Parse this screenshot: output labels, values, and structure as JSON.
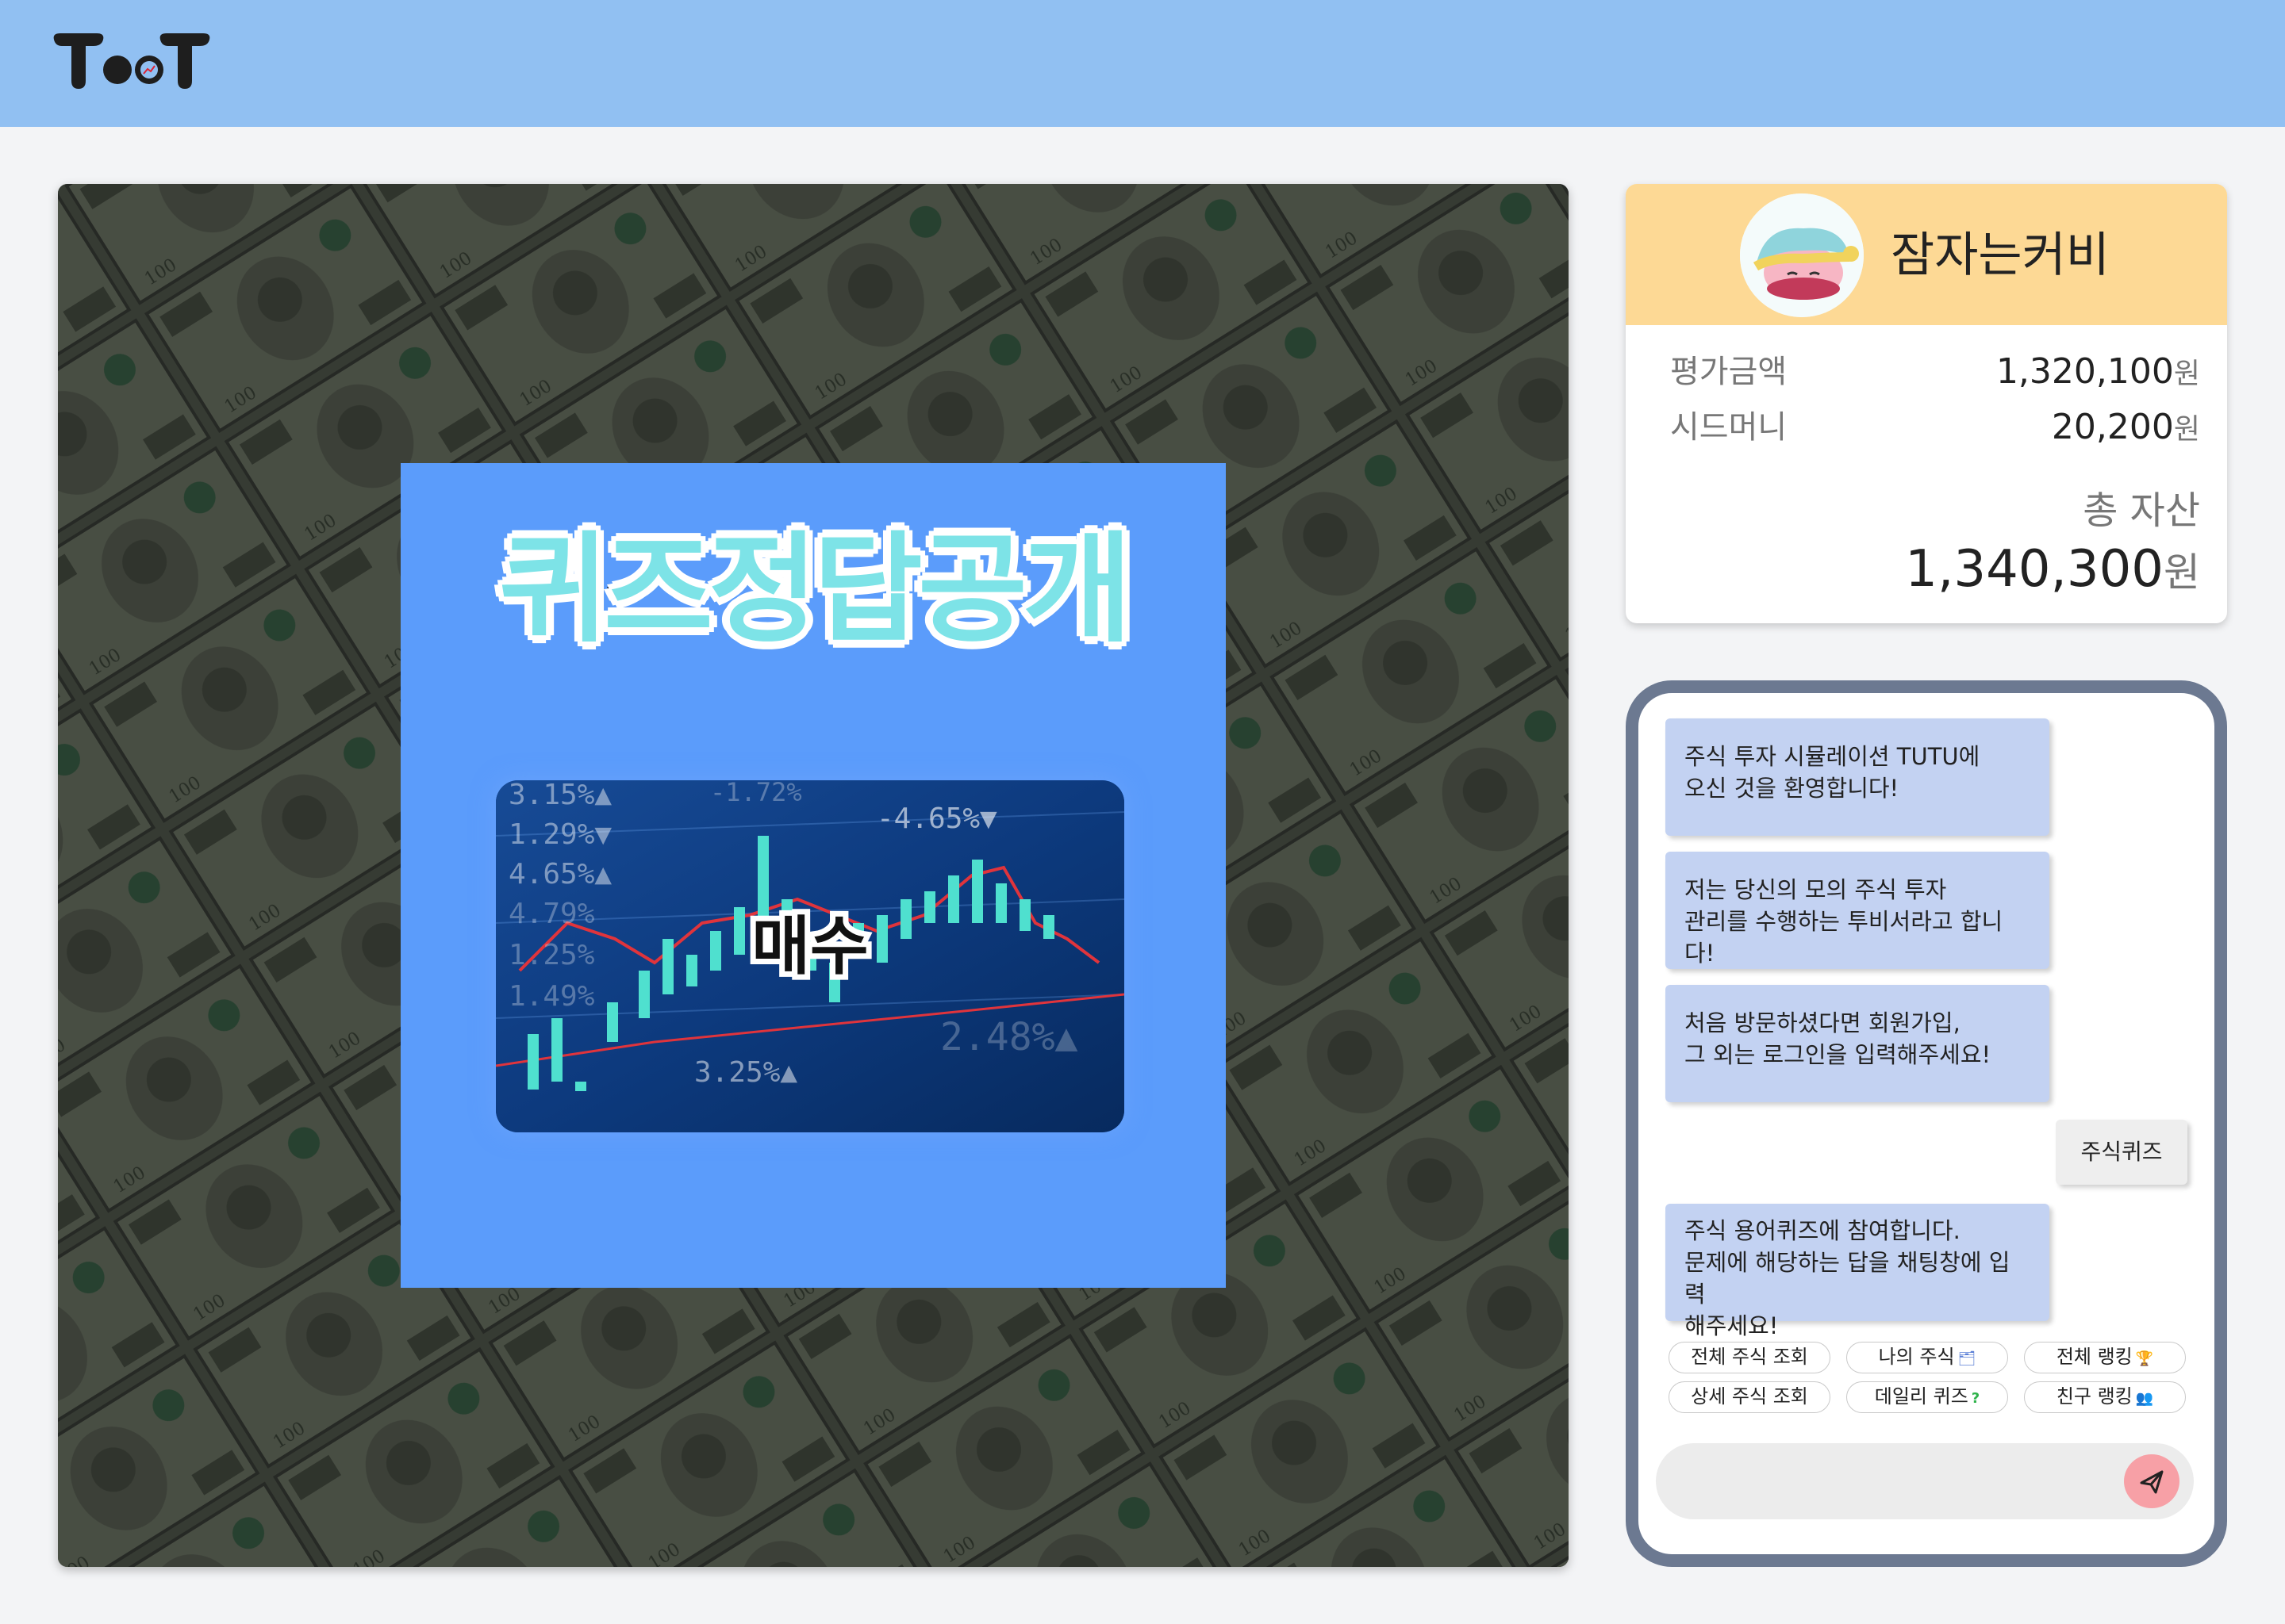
{
  "app": {
    "logo_text": "TooT"
  },
  "quiz": {
    "title": "퀴즈정답공개",
    "answer": "매수",
    "tickers": [
      "3.15%▲",
      "1.29%▼",
      "4.65%▲",
      "4.79%",
      "1.25%",
      "1.49%",
      "-1.72%",
      "-4.65%▼",
      "3.25%▲",
      "2.48%▲"
    ]
  },
  "profile": {
    "username": "잠자는커비",
    "rows": [
      {
        "label": "평가금액",
        "value": "1,320,100",
        "unit": "원"
      },
      {
        "label": "시드머니",
        "value": "20,200",
        "unit": "원"
      }
    ],
    "total_label": "총 자산",
    "total_value": "1,340,300",
    "total_unit": "원"
  },
  "chat": {
    "messages": [
      {
        "from": "bot",
        "lines": [
          "주식 투자 시뮬레이션 TUTU에",
          "오신 것을 환영합니다!"
        ]
      },
      {
        "from": "bot",
        "lines": [
          "저는 당신의 모의 주식 투자",
          "관리를 수행하는 투비서라고 합니다!"
        ]
      },
      {
        "from": "bot",
        "lines": [
          "처음 방문하셨다면 회원가입,",
          "그 외는 로그인을 입력해주세요!"
        ]
      },
      {
        "from": "user",
        "lines": [
          "주식퀴즈"
        ]
      },
      {
        "from": "bot",
        "lines": [
          "주식 용어퀴즈에 참여합니다.",
          "문제에 해당하는 답을 채팅창에 입력",
          "해주세요!"
        ]
      }
    ],
    "chips": [
      {
        "label": "전체 주식 조회",
        "icon": ""
      },
      {
        "label": "나의 주식",
        "icon": "🗂"
      },
      {
        "label": "전체 랭킹",
        "icon": "🏆"
      },
      {
        "label": "상세 주식 조회",
        "icon": ""
      },
      {
        "label": "데일리 퀴즈",
        "icon": "?"
      },
      {
        "label": "친구 랭킹",
        "icon": "👥"
      }
    ],
    "input_placeholder": "",
    "send_icon": "paper-plane-icon"
  },
  "colors": {
    "header": "#91c0f2",
    "quiz_card": "#5b9cfb",
    "profile_header": "#fdd995",
    "bot_bubble": "#c3d2f2",
    "chat_border": "#6c7991",
    "send_button": "#f7a0a6"
  }
}
